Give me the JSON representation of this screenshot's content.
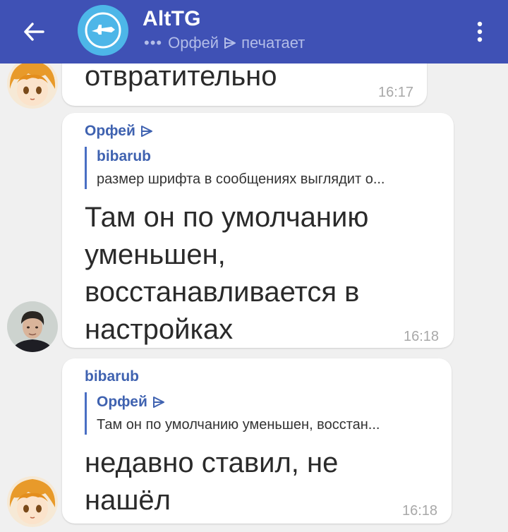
{
  "header": {
    "back_icon": "arrow-left-icon",
    "chat_logo_icon": "jet-plane-logo",
    "title": "AltTG",
    "status_dots": "•••",
    "status_user": "Орфей",
    "status_action": "печатает",
    "menu_icon": "more-vertical-icon",
    "colors": {
      "bar": "#3f51b5",
      "logo_bg": "#4db6e8",
      "status_text": "#b3bde8"
    }
  },
  "messages": [
    {
      "text": "отвратительно",
      "time": "16:17",
      "avatar": "anime-girl-avatar"
    },
    {
      "sender": "Орфей",
      "reply_to": {
        "name": "bibarub",
        "text": "размер шрифта в сообщениях выглядит о..."
      },
      "text_lines": [
        "Там он по умолчанию",
        "уменьшен,",
        "восстанавливается в",
        "настройках"
      ],
      "time": "16:18",
      "avatar": "young-man-avatar"
    },
    {
      "sender": "bibarub",
      "reply_to": {
        "name": "Орфей",
        "text": "Там он по умолчанию уменьшен, восстан..."
      },
      "text_lines": [
        "недавно ставил, не",
        "нашёл"
      ],
      "time": "16:18",
      "avatar": "anime-girl-avatar"
    }
  ],
  "colors": {
    "name_blue": "#3f62b0",
    "chat_bg": "#f0f0f0",
    "bubble_bg": "#ffffff",
    "time_gray": "#a8a8a8"
  }
}
